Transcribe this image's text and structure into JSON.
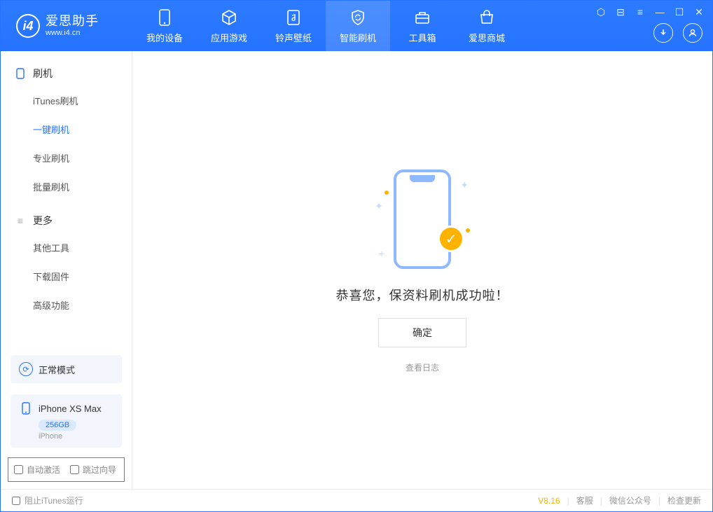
{
  "app": {
    "title": "爱思助手",
    "subtitle": "www.i4.cn"
  },
  "tabs": [
    {
      "label": "我的设备"
    },
    {
      "label": "应用游戏"
    },
    {
      "label": "铃声壁纸"
    },
    {
      "label": "智能刷机"
    },
    {
      "label": "工具箱"
    },
    {
      "label": "爱思商城"
    }
  ],
  "sidebar": {
    "sections": [
      {
        "title": "刷机",
        "items": [
          {
            "label": "iTunes刷机"
          },
          {
            "label": "一键刷机",
            "active": true
          },
          {
            "label": "专业刷机"
          },
          {
            "label": "批量刷机"
          }
        ]
      },
      {
        "title": "更多",
        "items": [
          {
            "label": "其他工具"
          },
          {
            "label": "下载固件"
          },
          {
            "label": "高级功能"
          }
        ]
      }
    ],
    "mode_label": "正常模式",
    "device": {
      "name": "iPhone XS Max",
      "storage": "256GB",
      "type": "iPhone"
    },
    "options": {
      "auto_activate": "自动激活",
      "skip_guide": "跳过向导"
    }
  },
  "main": {
    "success_text": "恭喜您，保资料刷机成功啦！",
    "ok_label": "确定",
    "log_label": "查看日志"
  },
  "footer": {
    "block_itunes": "阻止iTunes运行",
    "version": "V8.16",
    "links": {
      "support": "客服",
      "wechat": "微信公众号",
      "update": "检查更新"
    }
  }
}
